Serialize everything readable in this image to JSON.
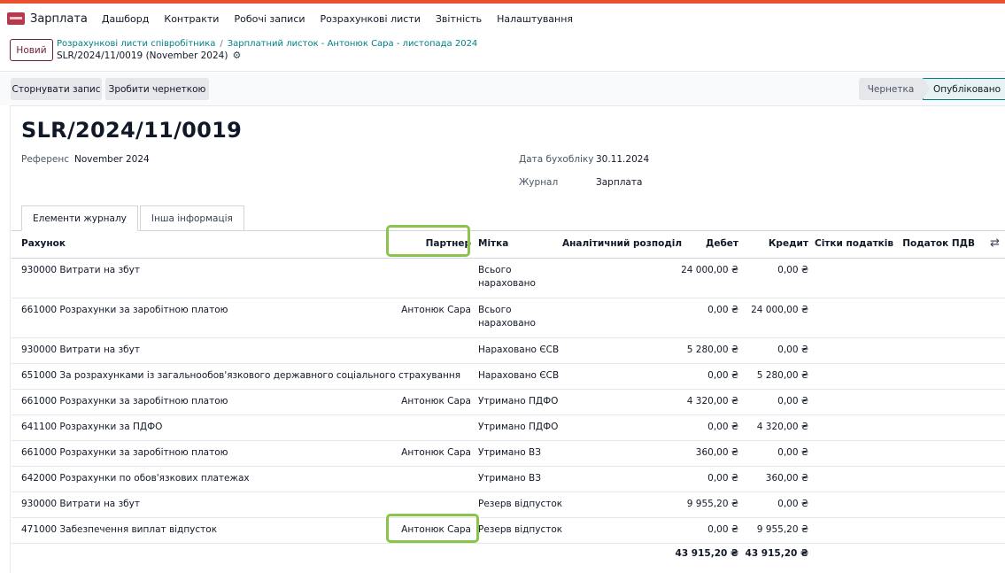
{
  "app": {
    "name": "Зарплата",
    "menu": [
      "Дашборд",
      "Контракти",
      "Робочі записи",
      "Розрахункові листи",
      "Звітність",
      "Налаштування"
    ]
  },
  "control_panel": {
    "new_button": "Новий",
    "breadcrumb": [
      "Розрахункові листи співробітника",
      "Зарплатний листок - Антонюк Сара - листопада 2024"
    ],
    "record_name": "SLR/2024/11/0019 (November 2024)",
    "gear_icon": "gear-icon"
  },
  "actions": {
    "reverse": "Сторнувати запис",
    "to_draft": "Зробити чернеткою"
  },
  "statusbar": {
    "stages": [
      "Чернетка",
      "Опубліковано"
    ],
    "current": "Опубліковано"
  },
  "form": {
    "title": "SLR/2024/11/0019",
    "ref_label": "Референс",
    "ref_value": "November 2024",
    "date_label": "Дата бухобліку",
    "date_value": "30.11.2024",
    "journal_label": "Журнал",
    "journal_value": "Зарплата"
  },
  "tabs": [
    "Елементи журналу",
    "Інша інформація"
  ],
  "table": {
    "columns": [
      "Рахунок",
      "Партнер",
      "Мітка",
      "Аналітичний розподіл",
      "Дебет",
      "Кредит",
      "Сітки податків",
      "Податок ПДВ"
    ],
    "settings_icon": "optional-columns-icon",
    "rows": [
      {
        "account": "930000 Витрати на збут",
        "partner": "",
        "label": "Всього нараховано",
        "debit": "24 000,00 ₴",
        "credit": "0,00 ₴"
      },
      {
        "account": "661000 Розрахунки за заробітною платою",
        "partner": "Антонюк Сара",
        "label": "Всього нараховано",
        "debit": "0,00 ₴",
        "credit": "24 000,00 ₴"
      },
      {
        "account": "930000 Витрати на збут",
        "partner": "",
        "label": "Нараховано ЄСВ",
        "debit": "5 280,00 ₴",
        "credit": "0,00 ₴"
      },
      {
        "account": "651000 За розрахунками із загальнообов'язкового державного соціального страхування",
        "partner": "",
        "label": "Нараховано ЄСВ",
        "debit": "0,00 ₴",
        "credit": "5 280,00 ₴"
      },
      {
        "account": "661000 Розрахунки за заробітною платою",
        "partner": "Антонюк Сара",
        "label": "Утримано ПДФО",
        "debit": "4 320,00 ₴",
        "credit": "0,00 ₴"
      },
      {
        "account": "641100 Розрахунки за ПДФО",
        "partner": "",
        "label": "Утримано ПДФО",
        "debit": "0,00 ₴",
        "credit": "4 320,00 ₴"
      },
      {
        "account": "661000 Розрахунки за заробітною платою",
        "partner": "Антонюк Сара",
        "label": "Утримано ВЗ",
        "debit": "360,00 ₴",
        "credit": "0,00 ₴"
      },
      {
        "account": "642000 Розрахунки по обов'язкових платежах",
        "partner": "",
        "label": "Утримано ВЗ",
        "debit": "0,00 ₴",
        "credit": "360,00 ₴"
      },
      {
        "account": "930000 Витрати на збут",
        "partner": "",
        "label": "Резерв відпусток",
        "debit": "9 955,20 ₴",
        "credit": "0,00 ₴"
      },
      {
        "account": "471000 Забезпечення виплат відпусток",
        "partner": "Антонюк Сара",
        "label": "Резерв відпусток",
        "debit": "0,00 ₴",
        "credit": "9 955,20 ₴"
      }
    ],
    "totals": {
      "debit": "43 915,20 ₴",
      "credit": "43 915,20 ₴"
    }
  },
  "highlight_color": "#8ac44a"
}
